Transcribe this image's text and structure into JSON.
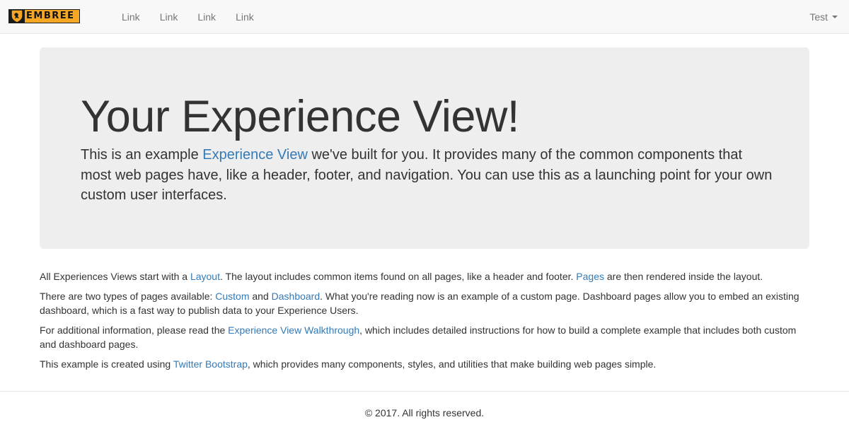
{
  "navbar": {
    "brand": {
      "wordmark": "EMBREE",
      "icon": "lion-shield-icon"
    },
    "links": [
      {
        "label": "Link"
      },
      {
        "label": "Link"
      },
      {
        "label": "Link"
      },
      {
        "label": "Link"
      }
    ],
    "user_menu": {
      "label": "Test",
      "icon": "caret-down-icon"
    }
  },
  "jumbotron": {
    "title": "Your Experience View!",
    "lead": {
      "before": "This is an example ",
      "link": "Experience View",
      "after": " we've built for you. It provides many of the common components that most web pages have, like a header, footer, and navigation. You can use this as a launching point for your own custom user interfaces."
    }
  },
  "content": {
    "p1": {
      "t1": "All Experiences Views start with a ",
      "link1": "Layout",
      "t2": ". The layout includes common items found on all pages, like a header and footer. ",
      "link2": "Pages",
      "t3": " are then rendered inside the layout."
    },
    "p2": {
      "t1": "There are two types of pages available: ",
      "link1": "Custom",
      "t2": " and ",
      "link2": "Dashboard",
      "t3": ". What you're reading now is an example of a custom page. Dashboard pages allow you to embed an existing dashboard, which is a fast way to publish data to your Experience Users."
    },
    "p3": {
      "t1": "For additional information, please read the ",
      "link1": "Experience View Walkthrough",
      "t2": ", which includes detailed instructions for how to build a complete example that includes both custom and dashboard pages."
    },
    "p4": {
      "t1": "This example is created using ",
      "link1": "Twitter Bootstrap",
      "t2": ", which provides many components, styles, and utilities that make building web pages simple."
    }
  },
  "footer": {
    "text": "© 2017. All rights reserved."
  },
  "colors": {
    "link": "#337ab7",
    "navbar_bg": "#f8f8f8",
    "jumbotron_bg": "#eeeeee",
    "brand_accent": "#f5a623"
  }
}
